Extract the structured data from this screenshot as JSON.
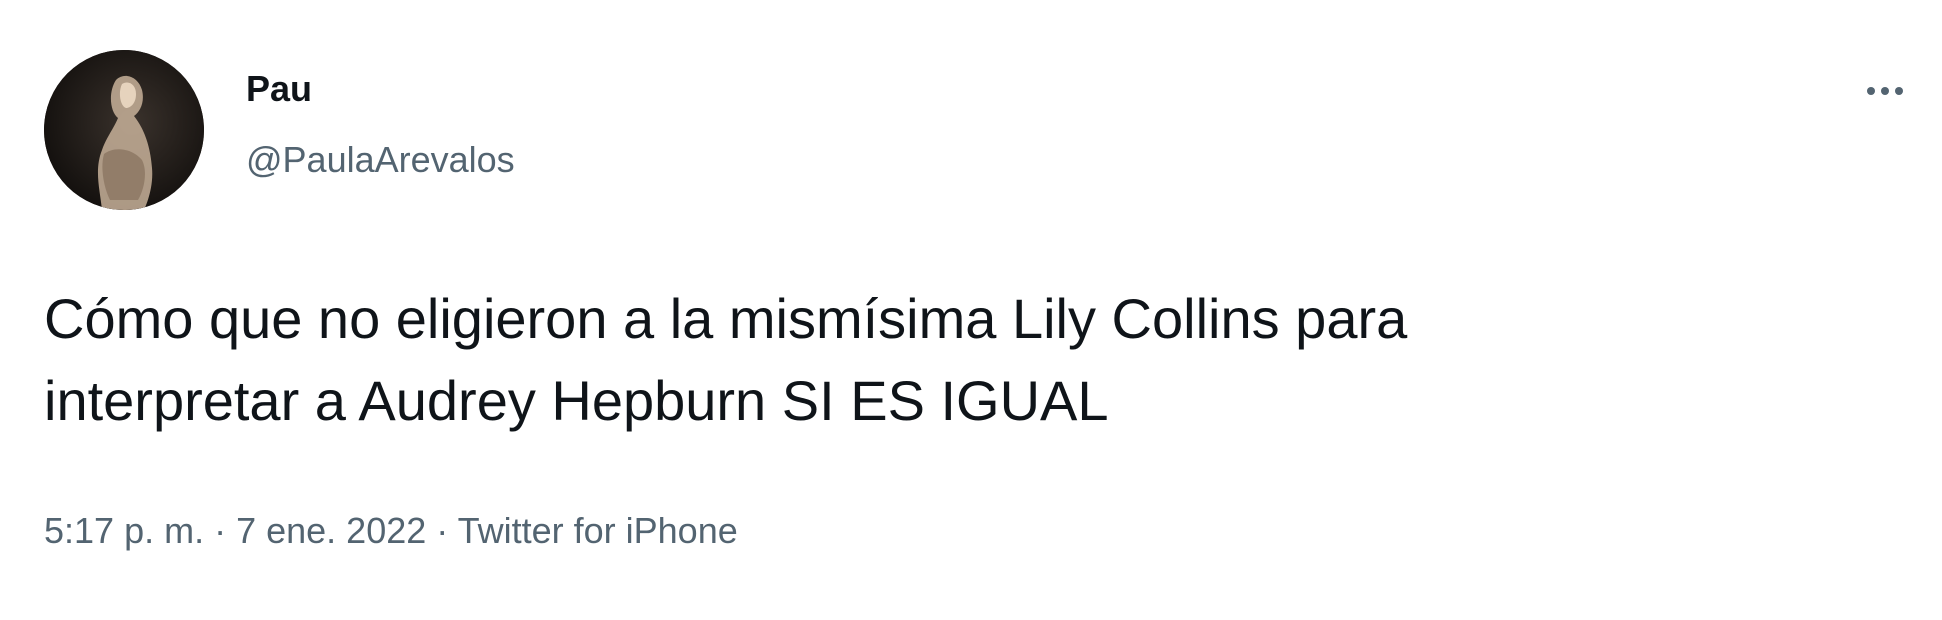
{
  "tweet": {
    "author": {
      "display_name": "Pau",
      "handle": "@PaulaArevalos",
      "avatar_icon": "profile-photo"
    },
    "more_icon": "more-options-icon",
    "text_lines": [
      "Cómo que no eligieron a la mismísima Lily Collins para",
      "interpretar a Audrey Hepburn SI ES IGUAL"
    ],
    "time": "5:17 p. m.",
    "separator": " · ",
    "date": "7 ene. 2022",
    "source": "Twitter for iPhone"
  },
  "colors": {
    "text_primary": "#0f1419",
    "text_secondary": "#536471",
    "background": "#ffffff"
  }
}
